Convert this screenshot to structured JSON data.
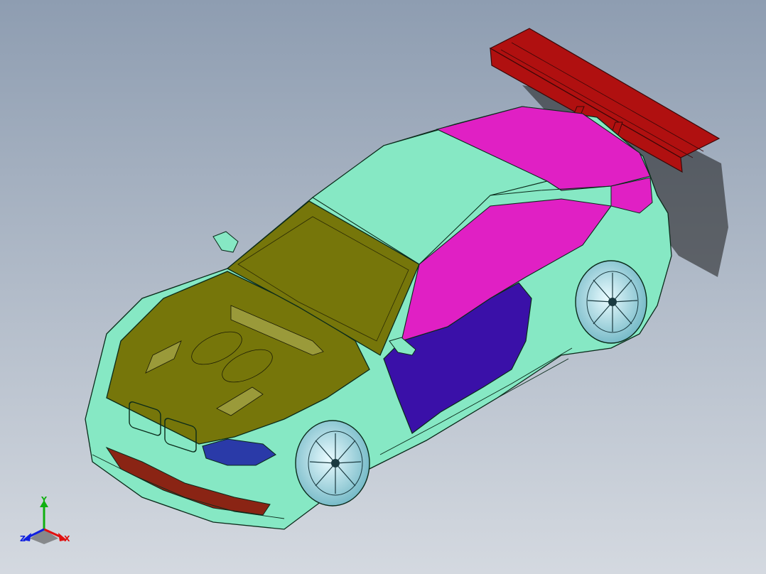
{
  "viewport": {
    "background_top": "#8e9db1",
    "background_bottom": "#d4d9e0"
  },
  "model": {
    "colors": {
      "body": "#86e8c4",
      "hood": "#76760a",
      "roof_rear": "#e020c4",
      "door": "#3a10a8",
      "wing": "#b01010",
      "bumper_lower": "#8a2414",
      "wheel_rim": "#a8e6ee",
      "headlight": "#2a3aa8",
      "outline": "#0a2a1a"
    }
  },
  "triad": {
    "x_label": "X",
    "y_label": "Y",
    "z_label": "Z",
    "x_color": "#e01010",
    "y_color": "#10b010",
    "z_color": "#1020e0"
  }
}
